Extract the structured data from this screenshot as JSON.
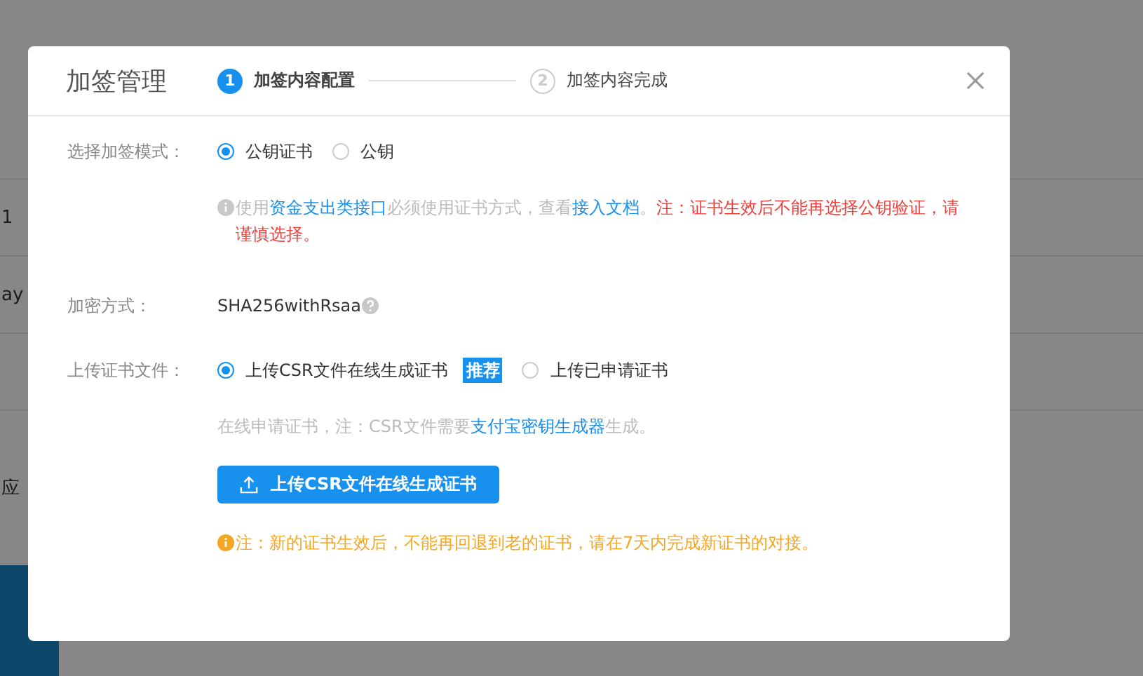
{
  "background": {
    "texts": [
      "1",
      "ay",
      "应"
    ]
  },
  "dialog": {
    "title": "加签管理",
    "steps": [
      {
        "number": "1",
        "label": "加签内容配置",
        "selected": true
      },
      {
        "number": "2",
        "label": "加签内容完成",
        "selected": false
      }
    ],
    "mode": {
      "label": "选择加签模式：",
      "options": [
        {
          "label": "公钥证书",
          "selected": true
        },
        {
          "label": "公钥",
          "selected": false
        }
      ],
      "note": [
        {
          "kind": "text",
          "text": "使用"
        },
        {
          "kind": "link",
          "text": "资金支出类接口"
        },
        {
          "kind": "text",
          "text": "必须使用证书方式，查看"
        },
        {
          "kind": "link",
          "text": "接入文档"
        },
        {
          "kind": "text",
          "text": "。"
        },
        {
          "kind": "warning",
          "text": "注：证书生效后不能再选择公钥验证，请谨慎选择。"
        }
      ]
    },
    "encryption": {
      "label": "加密方式：",
      "value": "SHA256withRsaa"
    },
    "upload": {
      "label": "上传证书文件：",
      "options": [
        {
          "label": "上传CSR文件在线生成证书",
          "badge": "推荐",
          "selected": true
        },
        {
          "label": "上传已申请证书",
          "selected": false
        }
      ],
      "note": [
        {
          "kind": "text",
          "text": "在线申请证书，注：CSR文件需要"
        },
        {
          "kind": "link",
          "text": "支付宝密钥生成器"
        },
        {
          "kind": "text",
          "text": "生成。"
        }
      ],
      "button": "上传CSR文件在线生成证书",
      "warning": "注：新的证书生效后，不能再回退到老的证书，请在7天内完成新证书的对接。"
    }
  }
}
